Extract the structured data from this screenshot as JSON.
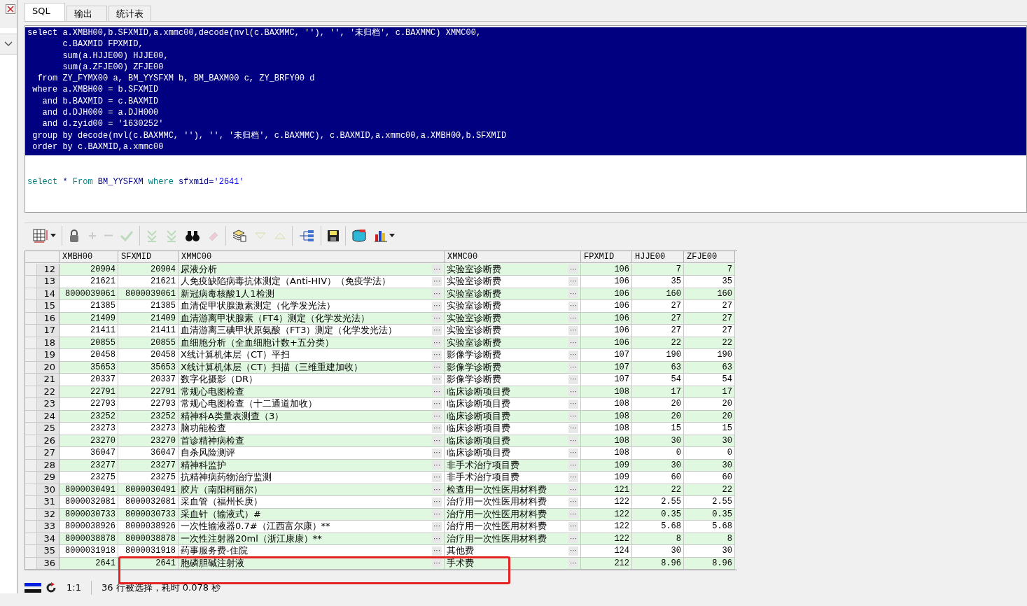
{
  "tabs": [
    {
      "label": "SQL",
      "selected": true
    },
    {
      "label": "输出",
      "selected": false
    },
    {
      "label": "统计表",
      "selected": false
    }
  ],
  "editor": {
    "blocks": [
      {
        "selected": true,
        "lines": [
          "select a.XMBH00,b.SFXMID,a.xmmc00,decode(nvl(c.BAXMMC, ''), '', '未归档', c.BAXMMC) XMMC00,",
          "       c.BAXMID FPXMID,",
          "       sum(a.HJJE00) HJJE00,",
          "       sum(a.ZFJE00) ZFJE00",
          "  from ZY_FYMX00 a, BM_YYSFXM b, BM_BAXM00 c, ZY_BRFY00 d",
          " where a.XMBH00 = b.SFXMID",
          "   and b.BAXMID = c.BAXMID",
          "   and d.DJH000 = a.DJH000",
          "   and d.zyid00 = '1630252'",
          " group by decode(nvl(c.BAXMMC, ''), '', '未归档', c.BAXMMC), c.BAXMID,a.xmmc00,a.XMBH00,b.SFXMID",
          " order by c.BAXMID,a.xmmc00"
        ]
      },
      {
        "selected": false,
        "tokens": [
          {
            "kind": "keyword",
            "text": "select"
          },
          {
            "kind": "plain",
            "text": " * "
          },
          {
            "kind": "keyword",
            "text": "From"
          },
          {
            "kind": "plain",
            "text": " BM_YYSFXM "
          },
          {
            "kind": "keyword",
            "text": "where"
          },
          {
            "kind": "plain",
            "text": " sfxmid="
          },
          {
            "kind": "string",
            "text": "'2641'"
          }
        ]
      }
    ]
  },
  "toolbar": [
    {
      "kind": "grid",
      "disabled": false,
      "menu": true
    },
    {
      "kind": "sep"
    },
    {
      "kind": "lock",
      "disabled": false
    },
    {
      "kind": "plus",
      "disabled": true
    },
    {
      "kind": "minus",
      "disabled": true
    },
    {
      "kind": "check",
      "disabled": true
    },
    {
      "kind": "sep"
    },
    {
      "kind": "down2",
      "disabled": true
    },
    {
      "kind": "down2",
      "disabled": true
    },
    {
      "kind": "binoculars",
      "disabled": false
    },
    {
      "kind": "eraser",
      "disabled": true
    },
    {
      "kind": "sep"
    },
    {
      "kind": "docs",
      "disabled": false
    },
    {
      "kind": "down",
      "disabled": true
    },
    {
      "kind": "up",
      "disabled": true
    },
    {
      "kind": "sep"
    },
    {
      "kind": "tree",
      "disabled": false
    },
    {
      "kind": "sep"
    },
    {
      "kind": "save",
      "disabled": false
    },
    {
      "kind": "sep"
    },
    {
      "kind": "db",
      "disabled": false
    },
    {
      "kind": "chart",
      "disabled": false,
      "menu": true
    }
  ],
  "table": {
    "columns": [
      "XMBH00",
      "SFXMID",
      "XMMC00",
      "XMMC00",
      "FPXMID",
      "HJJE00",
      "ZFJE00"
    ],
    "rows": [
      {
        "row": "12",
        "cells": [
          "20904",
          "20904",
          "尿液分析",
          "实验室诊断费",
          "106",
          "7",
          "7"
        ]
      },
      {
        "row": "13",
        "cells": [
          "21621",
          "21621",
          "人免疫缺陷病毒抗体测定（Anti-HIV）（免疫学法）",
          "实验室诊断费",
          "106",
          "35",
          "35"
        ]
      },
      {
        "row": "14",
        "cells": [
          "8000039061",
          "8000039061",
          "新冠病毒核酸1人1检测",
          "实验室诊断费",
          "106",
          "160",
          "160"
        ]
      },
      {
        "row": "15",
        "cells": [
          "21385",
          "21385",
          "血清促甲状腺激素测定（化学发光法）",
          "实验室诊断费",
          "106",
          "27",
          "27"
        ]
      },
      {
        "row": "16",
        "cells": [
          "21409",
          "21409",
          "血清游离甲状腺素（FT4）测定（化学发光法）",
          "实验室诊断费",
          "106",
          "27",
          "27"
        ]
      },
      {
        "row": "17",
        "cells": [
          "21411",
          "21411",
          "血清游离三碘甲状原氨酸（FT3）测定（化学发光法）",
          "实验室诊断费",
          "106",
          "27",
          "27"
        ]
      },
      {
        "row": "18",
        "cells": [
          "20855",
          "20855",
          "血细胞分析（全血细胞计数+五分类）",
          "实验室诊断费",
          "106",
          "22",
          "22"
        ]
      },
      {
        "row": "19",
        "cells": [
          "20458",
          "20458",
          "X线计算机体层（CT）平扫",
          "影像学诊断费",
          "107",
          "190",
          "190"
        ]
      },
      {
        "row": "20",
        "cells": [
          "35653",
          "35653",
          "X线计算机体层（CT）扫描（三维重建加收）",
          "影像学诊断费",
          "107",
          "63",
          "63"
        ]
      },
      {
        "row": "21",
        "cells": [
          "20337",
          "20337",
          "数字化摄影（DR）",
          "影像学诊断费",
          "107",
          "54",
          "54"
        ]
      },
      {
        "row": "22",
        "cells": [
          "22791",
          "22791",
          "常规心电图检查",
          "临床诊断项目费",
          "108",
          "17",
          "17"
        ]
      },
      {
        "row": "23",
        "cells": [
          "22793",
          "22793",
          "常规心电图检查（十二通道加收）",
          "临床诊断项目费",
          "108",
          "20",
          "20"
        ]
      },
      {
        "row": "24",
        "cells": [
          "23252",
          "23252",
          "精神科A类量表测查（3）",
          "临床诊断项目费",
          "108",
          "20",
          "20"
        ]
      },
      {
        "row": "25",
        "cells": [
          "23273",
          "23273",
          "脑功能检查",
          "临床诊断项目费",
          "108",
          "15",
          "15"
        ]
      },
      {
        "row": "26",
        "cells": [
          "23270",
          "23270",
          "首诊精神病检查",
          "临床诊断项目费",
          "108",
          "30",
          "30"
        ]
      },
      {
        "row": "27",
        "cells": [
          "36047",
          "36047",
          "自杀风险测评",
          "临床诊断项目费",
          "108",
          "0",
          "0"
        ]
      },
      {
        "row": "28",
        "cells": [
          "23277",
          "23277",
          "精神科监护",
          "非手术治疗项目费",
          "109",
          "30",
          "30"
        ]
      },
      {
        "row": "29",
        "cells": [
          "23275",
          "23275",
          "抗精神病药物治疗监测",
          "非手术治疗项目费",
          "109",
          "60",
          "60"
        ]
      },
      {
        "row": "30",
        "cells": [
          "8000030491",
          "8000030491",
          "胶片（南阳柯丽尔）",
          "检查用一次性医用材料费",
          "121",
          "22",
          "22"
        ]
      },
      {
        "row": "31",
        "cells": [
          "8000032081",
          "8000032081",
          "采血管（福州长庚）",
          "治疗用一次性医用材料费",
          "122",
          "2.55",
          "2.55"
        ]
      },
      {
        "row": "32",
        "cells": [
          "8000030733",
          "8000030733",
          "采血针（输液式）#",
          "治疗用一次性医用材料费",
          "122",
          "0.35",
          "0.35"
        ]
      },
      {
        "row": "33",
        "cells": [
          "8000038926",
          "8000038926",
          "一次性输液器0.7#（江西富尔康）**",
          "治疗用一次性医用材料费",
          "122",
          "5.68",
          "5.68"
        ]
      },
      {
        "row": "34",
        "cells": [
          "8000038878",
          "8000038878",
          "一次性注射器20ml（浙江康康）**",
          "治疗用一次性医用材料费",
          "122",
          "8",
          "8"
        ]
      },
      {
        "row": "35",
        "cells": [
          "8000031918",
          "8000031918",
          "药事服务费-住院",
          "其他费",
          "124",
          "30",
          "30"
        ]
      },
      {
        "row": "36",
        "cells": [
          "2641",
          "2641",
          "胞磷胆碱注射液",
          "手术费",
          "212",
          "8.96",
          "8.96"
        ]
      }
    ],
    "cell_button": "···"
  },
  "status_bar": {
    "zoom": "1:1",
    "message": "36 行被选择，耗时 0.078 秒"
  }
}
